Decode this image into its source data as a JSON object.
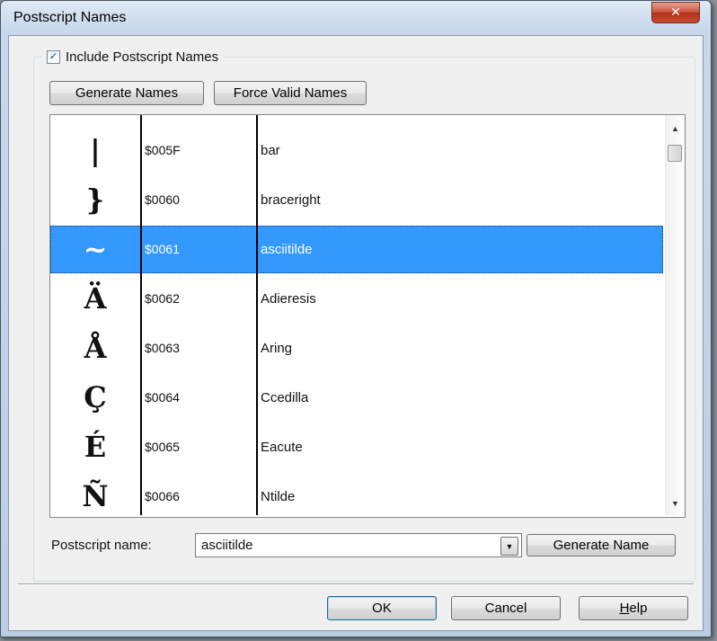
{
  "window": {
    "title": "Postscript Names",
    "close_symbol": "✕"
  },
  "group": {
    "checkbox_checked": true,
    "checkbox_mark": "✓",
    "checkbox_label": "Include Postscript Names",
    "generate_names_label": "Generate Names",
    "force_valid_names_label": "Force Valid Names"
  },
  "table": {
    "rows": [
      {
        "glyph": "|",
        "code": "$005F",
        "name": "bar"
      },
      {
        "glyph": "}",
        "code": "$0060",
        "name": "braceright"
      },
      {
        "glyph": "~",
        "code": "$0061",
        "name": "asciitilde"
      },
      {
        "glyph": "Ä",
        "code": "$0062",
        "name": "Adieresis"
      },
      {
        "glyph": "Å",
        "code": "$0063",
        "name": "Aring"
      },
      {
        "glyph": "Ç",
        "code": "$0064",
        "name": "Ccedilla"
      },
      {
        "glyph": "É",
        "code": "$0065",
        "name": "Eacute"
      },
      {
        "glyph": "Ñ",
        "code": "$0066",
        "name": "Ntilde"
      }
    ],
    "selected_row_index": 2,
    "scroll_up_symbol": "▲",
    "scroll_down_symbol": "▼"
  },
  "footer": {
    "postscript_name_label": "Postscript name:",
    "postscript_name_value": "asciitilde",
    "dropdown_symbol": "▼",
    "generate_name_label": "Generate Name"
  },
  "dialog_buttons": {
    "ok_label": "OK",
    "cancel_label": "Cancel",
    "help_mnemonic": "H",
    "help_rest": "elp"
  },
  "colors": {
    "selection": "#3399ff",
    "close_button": "#c9503a"
  }
}
